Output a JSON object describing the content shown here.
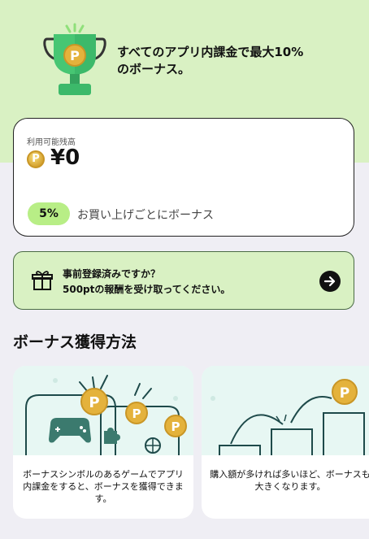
{
  "hero": {
    "headline_line1": "すべてのアプリ内課金で最大10%",
    "headline_line2": "のボーナス。",
    "trophy_icon": "trophy-icon"
  },
  "balance": {
    "label": "利用可能残高",
    "amount": "¥0",
    "coin_symbol": "P",
    "bonus_rate": "5%",
    "bonus_text": "お買い上げごとにボーナス"
  },
  "prereg": {
    "line1": "事前登録済みですか？",
    "line2": "500ptの報酬を受け取ってください。",
    "icon": "gift-icon",
    "action_icon": "arrow-right-icon"
  },
  "section": {
    "title": "ボーナス獲得方法"
  },
  "cards": [
    {
      "text": "ボーナスシンボルのあるゲームでアプリ内課金をすると、ボーナスを獲得できます。"
    },
    {
      "text": "購入額が多ければ多いほど、ボーナスも大きくなります。"
    }
  ],
  "colors": {
    "hero_bg": "#d9f1c3",
    "accent_green": "#b8ee86",
    "trophy_green": "#3cb96a",
    "coin_gold": "#d6a432",
    "page_bg": "#efeef4"
  }
}
